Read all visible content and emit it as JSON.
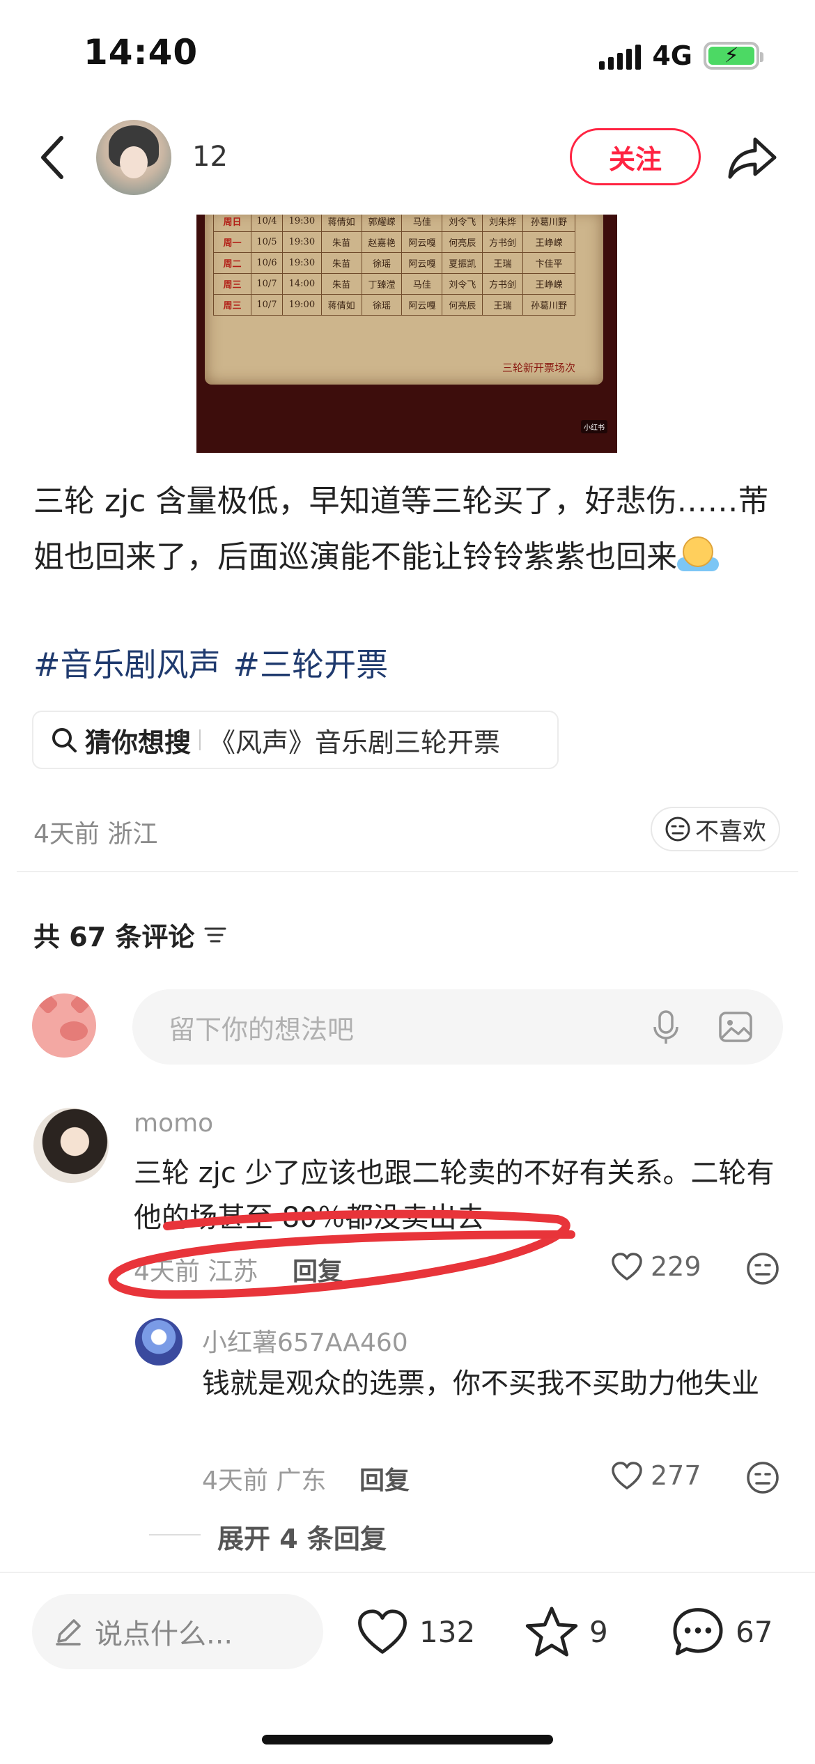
{
  "status_bar": {
    "time": "14:40",
    "network": "4G"
  },
  "author": {
    "name": "12",
    "follow_label": "关注"
  },
  "poster": {
    "rows": [
      [
        "周日",
        "10/4",
        "19:30",
        "蒋倩如",
        "郭耀嵘",
        "马佳",
        "刘令飞",
        "刘朱烨",
        "孙葛川野"
      ],
      [
        "周一",
        "10/5",
        "19:30",
        "朱苗",
        "赵嘉艳",
        "阿云嘎",
        "何亮辰",
        "方书剑",
        "王峥嵘"
      ],
      [
        "周二",
        "10/6",
        "19:30",
        "朱苗",
        "徐瑶",
        "阿云嘎",
        "夏振凯",
        "王瑞",
        "卞佳平"
      ],
      [
        "周三",
        "10/7",
        "14:00",
        "朱苗",
        "丁臻滢",
        "马佳",
        "刘令飞",
        "方书剑",
        "王峥嵘"
      ],
      [
        "周三",
        "10/7",
        "19:00",
        "蒋倩如",
        "徐瑶",
        "阿云嘎",
        "何亮辰",
        "王瑞",
        "孙葛川野"
      ]
    ],
    "footer": "三轮新开票场次",
    "watermark": "小红书"
  },
  "post": {
    "text": "三轮 zjc 含量极低，早知道等三轮买了，好悲伤……芾姐也回来了，后面巡演能不能让铃铃紫紫也回来",
    "tags": [
      "#音乐剧风声",
      "#三轮开票"
    ],
    "suggest_label": "猜你想搜",
    "suggest_query": "《风声》音乐剧三轮开票",
    "meta": "4天前 浙江",
    "dislike_label": "不喜欢"
  },
  "comments_header": "共 67 条评论",
  "comment_input_placeholder": "留下你的想法吧",
  "comments": [
    {
      "name": "momo",
      "text": "三轮 zjc 少了应该也跟二轮卖的不好有关系。二轮有他的场甚至 80％都没卖出去",
      "meta": "4天前 江苏",
      "reply_label": "回复",
      "likes": "229"
    },
    {
      "name": "小红薯657AA460",
      "text": "钱就是观众的选票，你不买我不买助力他失业",
      "meta": "4天前 广东",
      "reply_label": "回复",
      "likes": "277"
    }
  ],
  "expand_replies_label": "展开 4 条回复",
  "bottom_bar": {
    "say_placeholder": "说点什么...",
    "likes": "132",
    "stars": "9",
    "comments": "67"
  },
  "colors": {
    "accent": "#ff2442",
    "tag": "#1f3a6e",
    "annotation": "#e8343a"
  }
}
